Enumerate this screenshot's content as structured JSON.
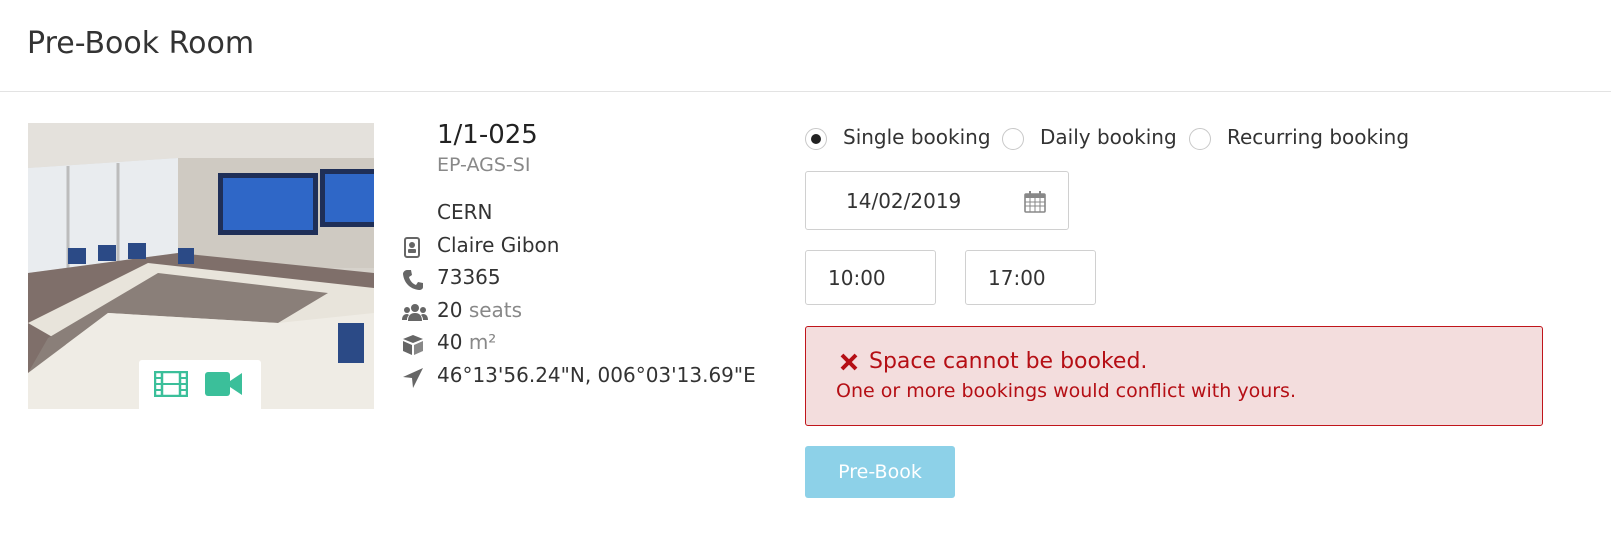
{
  "page": {
    "title": "Pre-Book Room"
  },
  "room": {
    "name": "1/1-025",
    "division": "EP-AGS-SI",
    "site": "CERN",
    "owner": "Claire Gibon",
    "phone": "73365",
    "capacity": "20",
    "capacity_unit": "seats",
    "surface": "40",
    "surface_unit": "m²",
    "coordinates": "46°13'56.24\"N, 006°03'13.69\"E",
    "equipment_icons": [
      "film-icon",
      "video-camera-icon"
    ],
    "equipment_color": "#3bbf9a"
  },
  "booking": {
    "types": [
      {
        "label": "Single booking",
        "checked": true
      },
      {
        "label": "Daily booking",
        "checked": false
      },
      {
        "label": "Recurring booking",
        "checked": false
      }
    ],
    "date": "14/02/2019",
    "start_time": "10:00",
    "end_time": "17:00",
    "error": {
      "title": "Space cannot be booked.",
      "message": "One or more bookings would conflict with yours.",
      "color": "#b50f15"
    },
    "submit_label": "Pre-Book",
    "submit_color": "#8dd1e8"
  }
}
